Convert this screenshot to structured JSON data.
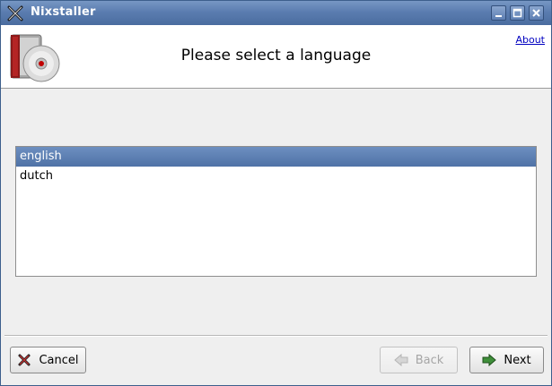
{
  "window": {
    "title": "Nixstaller"
  },
  "header": {
    "heading": "Please select a language",
    "about_label": "About"
  },
  "languages": {
    "items": [
      {
        "label": "english",
        "selected": true
      },
      {
        "label": "dutch",
        "selected": false
      }
    ]
  },
  "buttons": {
    "cancel_label": "Cancel",
    "back_label": "Back",
    "next_label": "Next"
  },
  "colors": {
    "titlebar": "#5b7db0",
    "selection": "#5a7db0",
    "link": "#0000c0"
  }
}
